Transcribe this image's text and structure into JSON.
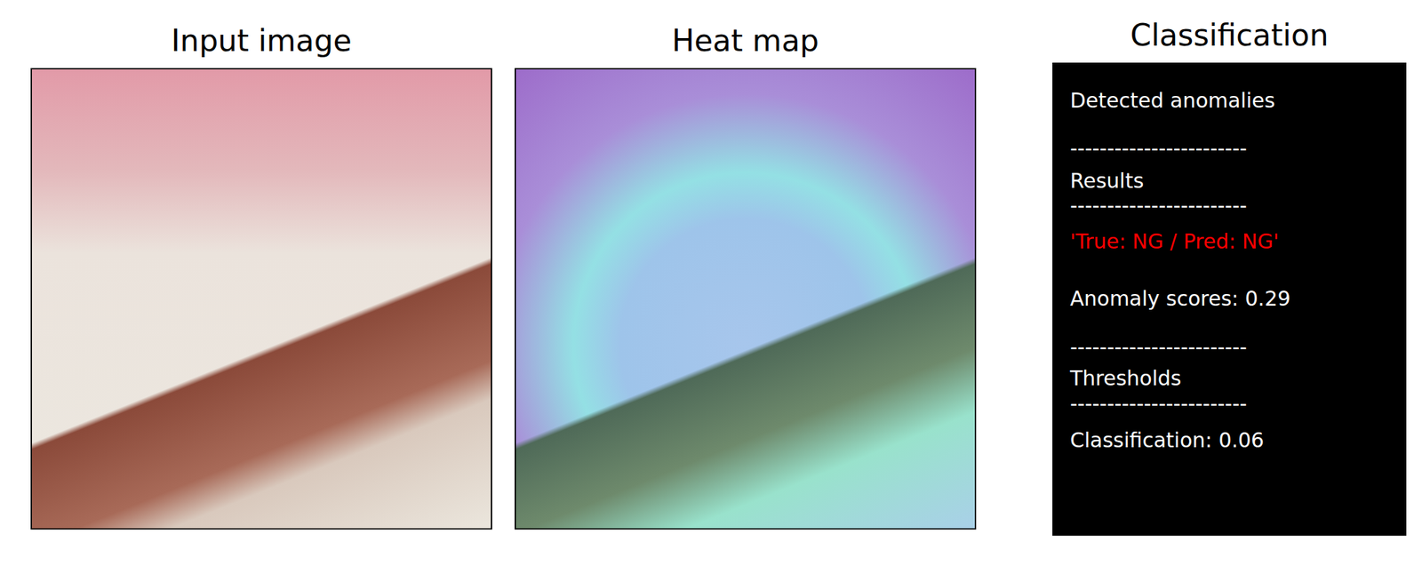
{
  "figure": {
    "panels": [
      {
        "title": "Input image",
        "kind": "photo"
      },
      {
        "title": "Heat map",
        "kind": "heatmap"
      }
    ],
    "classification": {
      "title": "Classification",
      "lines": [
        {
          "text": "Detected anomalies",
          "kind": "text"
        },
        {
          "text": "------------------------",
          "kind": "rule"
        },
        {
          "text": "Results",
          "kind": "text"
        },
        {
          "text": "------------------------",
          "kind": "rule"
        },
        {
          "text": "'True: NG / Pred: NG'",
          "kind": "result"
        },
        {
          "text": "Anomaly scores: 0.29",
          "kind": "text"
        },
        {
          "text": "------------------------",
          "kind": "rule"
        },
        {
          "text": "Thresholds",
          "kind": "text"
        },
        {
          "text": "------------------------",
          "kind": "rule"
        },
        {
          "text": "Classification: 0.06",
          "kind": "text"
        }
      ]
    }
  }
}
